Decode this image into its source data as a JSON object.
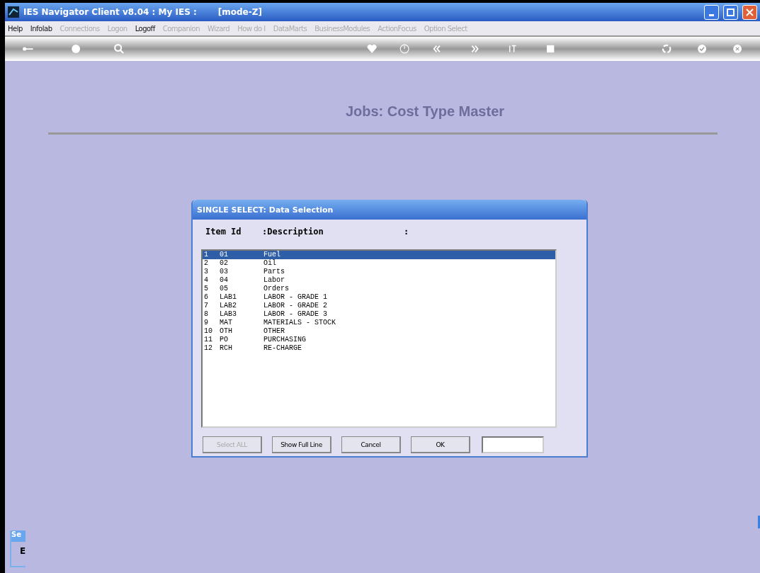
{
  "window": {
    "title": "IES Navigator Client v8.04 : My IES :",
    "mode": "[mode-Z]"
  },
  "menu": [
    {
      "label": "Help",
      "disabled": false
    },
    {
      "label": "Infolab",
      "disabled": false
    },
    {
      "label": "Connections",
      "disabled": true
    },
    {
      "label": "Logon",
      "disabled": true
    },
    {
      "label": "Logoff",
      "disabled": false
    },
    {
      "label": "Companion",
      "disabled": true
    },
    {
      "label": "Wizard",
      "disabled": true
    },
    {
      "label": "How do I",
      "disabled": true
    },
    {
      "label": "DataMarts",
      "disabled": true
    },
    {
      "label": "BusinessModules",
      "disabled": true
    },
    {
      "label": "ActionFocus",
      "disabled": true
    },
    {
      "label": "Option Select",
      "disabled": true
    }
  ],
  "page_title": "Jobs: Cost Type Master",
  "dialog": {
    "title": "SINGLE SELECT: Data Selection",
    "columns": [
      "Item Id",
      ":Description",
      ":"
    ],
    "rows": [
      {
        "num": "1",
        "id": "01",
        "description": "Fuel",
        "selected": true
      },
      {
        "num": "2",
        "id": "02",
        "description": "Oil",
        "selected": false
      },
      {
        "num": "3",
        "id": "03",
        "description": "Parts",
        "selected": false
      },
      {
        "num": "4",
        "id": "04",
        "description": "Labor",
        "selected": false
      },
      {
        "num": "5",
        "id": "05",
        "description": "Orders",
        "selected": false
      },
      {
        "num": "6",
        "id": "LAB1",
        "description": "LABOR - GRADE 1",
        "selected": false
      },
      {
        "num": "7",
        "id": "LAB2",
        "description": "LABOR - GRADE 2",
        "selected": false
      },
      {
        "num": "8",
        "id": "LAB3",
        "description": "LABOR - GRADE 3",
        "selected": false
      },
      {
        "num": "9",
        "id": "MAT",
        "description": "MATERIALS - STOCK",
        "selected": false
      },
      {
        "num": "10",
        "id": "OTH",
        "description": "OTHER",
        "selected": false
      },
      {
        "num": "11",
        "id": "PO",
        "description": "PURCHASING",
        "selected": false
      },
      {
        "num": "12",
        "id": "RCH",
        "description": "RE-CHARGE",
        "selected": false
      }
    ],
    "buttons": [
      {
        "label": "Select ALL",
        "disabled": true
      },
      {
        "label": "Show Full Line",
        "disabled": false
      },
      {
        "label": "Cancel",
        "disabled": false
      },
      {
        "label": "OK",
        "disabled": false
      }
    ]
  },
  "side_panel": {
    "title": "Se",
    "text": "E"
  }
}
